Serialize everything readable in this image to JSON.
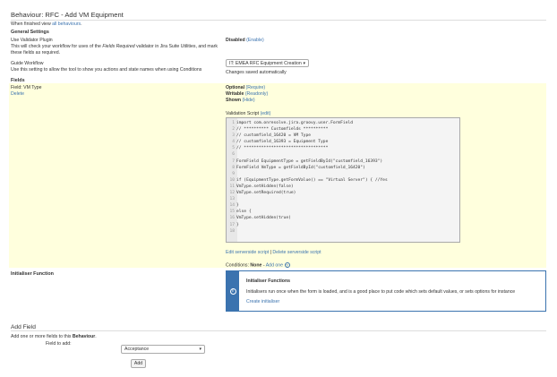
{
  "header": {
    "title": "Behaviour: RFC - Add VM Equipment",
    "finished_prefix": "When finished view ",
    "finished_link": "all behaviours",
    "finished_suffix": "."
  },
  "general_settings": {
    "heading": "General Settings",
    "validator_label": "Use Validator Plugin",
    "validator_desc_1": "This will check your workflow for uses of the ",
    "validator_desc_em": "Fields Required",
    "validator_desc_2": " validator in Jira Suite Utilities, and mark",
    "validator_desc_3": "these fields as required.",
    "validator_status": "Disabled",
    "validator_action": "(Enable)",
    "guide_label": "Guide Workflow",
    "guide_desc": "Use this setting to allow the tool to show you actions and state names when using Conditions",
    "guide_select_value": "IT: EMEA RFC Equipment Creation",
    "guide_note": "Changes saved automatically"
  },
  "fields": {
    "heading": "Fields",
    "field_label": "Field: VM Type",
    "delete_link": "Delete",
    "optional_label": "Optional",
    "optional_action": "(Require)",
    "writable_label": "Writable",
    "writable_action": "(Readonly)",
    "shown_label": "Shown",
    "shown_action": "(Hide)",
    "validation_label": "Validation Script",
    "validation_action": "(edit)",
    "code_lines": [
      "import com.onresolve.jira.groovy.user.FormField",
      "// ********** Customfields **********",
      "// customfield_16420 = VM Type",
      "// customfield_16393 = Equipment Type",
      "// **********************************",
      "",
      "FormField EquipmentType = getFieldById(\"customfield_16393\")",
      "FormField VmType = getFieldById(\"customfield_16420\")",
      "",
      "if (EquipmentType.getFormValue() == \"Virtual Server\") { //Yes",
      "VmType.setHidden(false)",
      "VmType.setRequired(true)",
      "",
      "}",
      "else {",
      "VmType.setHidden(true)",
      "}",
      ""
    ],
    "edit_serverside": "Edit serverside script",
    "separator": "|",
    "delete_serverside": "Delete serverside script",
    "conditions_label": "Conditions:",
    "conditions_value": "None",
    "conditions_dash": "-",
    "add_one": "Add one",
    "help_glyph": "?"
  },
  "initialiser": {
    "label": "Initialiser Function",
    "info_title": "Initialiser Functions",
    "info_text": "Initialisers run once when the form is loaded, and is a good place to put code which sets default values, or sets options for instance",
    "create_link": "Create initialiser",
    "info_glyph": "i"
  },
  "add_field": {
    "heading": "Add Field",
    "desc_prefix": "Add one or more fields to this ",
    "desc_bold": "Behaviour",
    "desc_suffix": ".",
    "field_to_add_label": "Field to add:",
    "select_value": "Acceptance",
    "add_button": "Add"
  },
  "colors": {
    "accent": "#3b73af",
    "field_bg": "#ffffdd",
    "code_bg": "#f4f4f4"
  }
}
